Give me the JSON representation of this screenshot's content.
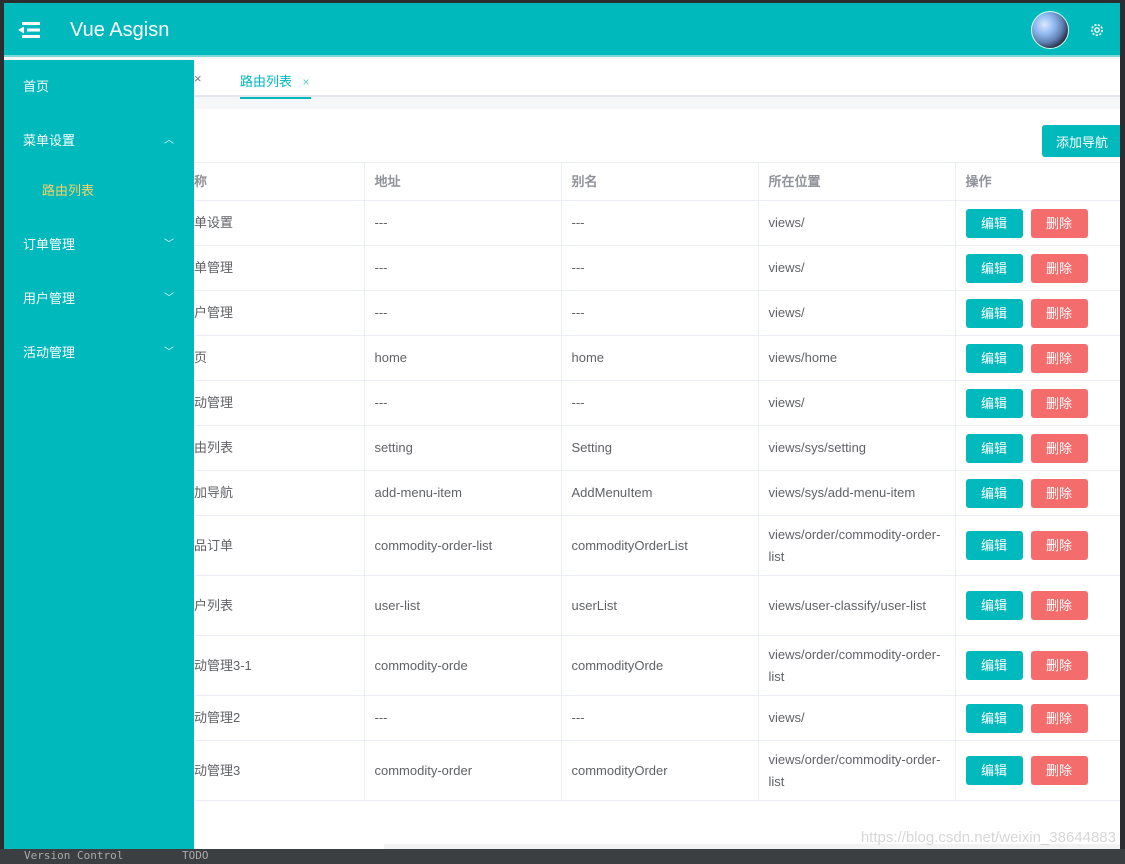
{
  "header": {
    "title": "Vue Asgisn",
    "menu_icon": "menu-fold-icon",
    "avatar": "user-avatar",
    "settings_icon": "gear-icon"
  },
  "tabs": {
    "prev_close": "×",
    "items": [
      {
        "label": "路由列表",
        "close": "×",
        "active": true
      }
    ]
  },
  "sidebar": {
    "items": [
      {
        "label": "首页",
        "chevron": ""
      },
      {
        "label": "菜单设置",
        "chevron": "^",
        "expanded": true
      },
      {
        "label": "路由列表",
        "sub": true,
        "active": true
      },
      {
        "label": "订单管理",
        "chevron": "⌄"
      },
      {
        "label": "用户管理",
        "chevron": "⌄"
      },
      {
        "label": "活动管理",
        "chevron": "⌄"
      }
    ]
  },
  "toolbar": {
    "add_label": "添加导航"
  },
  "table": {
    "headers": [
      "称",
      "地址",
      "别名",
      "所在位置",
      "操作"
    ],
    "edit_label": "编辑",
    "delete_label": "删除",
    "rows": [
      {
        "name": "单设置",
        "path": "---",
        "alias": "---",
        "location": "views/"
      },
      {
        "name": "单管理",
        "path": "---",
        "alias": "---",
        "location": "views/"
      },
      {
        "name": "户管理",
        "path": "---",
        "alias": "---",
        "location": "views/"
      },
      {
        "name": "页",
        "path": "home",
        "alias": "home",
        "location": "views/home"
      },
      {
        "name": "动管理",
        "path": "---",
        "alias": "---",
        "location": "views/"
      },
      {
        "name": "由列表",
        "path": "setting",
        "alias": "Setting",
        "location": "views/sys/setting"
      },
      {
        "name": "加导航",
        "path": "add-menu-item",
        "alias": "AddMenuItem",
        "location": "views/sys/add-menu-item"
      },
      {
        "name": "品订单",
        "path": "commodity-order-list",
        "alias": "commodityOrderList",
        "location": "views/order/commodity-order-list"
      },
      {
        "name": "户列表",
        "path": "user-list",
        "alias": "userList",
        "location": "views/user-classify/user-list"
      },
      {
        "name": "动管理3-1",
        "path": "commodity-orde",
        "alias": "commodityOrde",
        "location": "views/order/commodity-order-list"
      },
      {
        "name": "动管理2",
        "path": "---",
        "alias": "---",
        "location": "views/"
      },
      {
        "name": "动管理3",
        "path": "commodity-order",
        "alias": "commodityOrder",
        "location": "views/order/commodity-order-list"
      }
    ]
  },
  "watermark": "https://blog.csdn.net/weixin_38644883",
  "ide": {
    "version_control": "Version Control",
    "todo": "TODO"
  },
  "colors": {
    "primary": "#00b9bd",
    "danger": "#f56c6c",
    "active_sub": "#f8d264"
  }
}
